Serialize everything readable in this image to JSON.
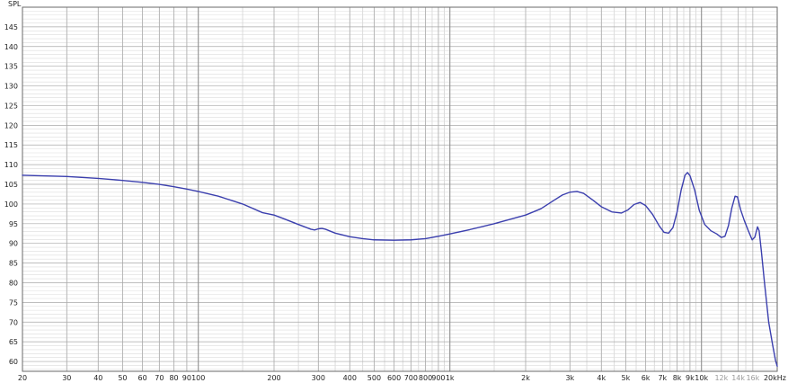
{
  "chart_data": {
    "type": "line",
    "ylabel": "SPL",
    "x_scale": "log",
    "xlim": [
      20,
      20000
    ],
    "ylim": [
      57.5,
      150
    ],
    "grid": true,
    "y_ticks": [
      60,
      65,
      70,
      75,
      80,
      85,
      90,
      95,
      100,
      105,
      110,
      115,
      120,
      125,
      130,
      135,
      140,
      145
    ],
    "x_ticks": [
      {
        "value": 20,
        "label": "20"
      },
      {
        "value": 30,
        "label": "30"
      },
      {
        "value": 40,
        "label": "40"
      },
      {
        "value": 50,
        "label": "50"
      },
      {
        "value": 60,
        "label": "60"
      },
      {
        "value": 70,
        "label": "70"
      },
      {
        "value": 80,
        "label": "80"
      },
      {
        "value": 90,
        "label": "90"
      },
      {
        "value": 100,
        "label": "100"
      },
      {
        "value": 200,
        "label": "200"
      },
      {
        "value": 300,
        "label": "300"
      },
      {
        "value": 400,
        "label": "400"
      },
      {
        "value": 500,
        "label": "500"
      },
      {
        "value": 600,
        "label": "600"
      },
      {
        "value": 700,
        "label": "700"
      },
      {
        "value": 800,
        "label": "800"
      },
      {
        "value": 900,
        "label": "900"
      },
      {
        "value": 1000,
        "label": "1k"
      },
      {
        "value": 2000,
        "label": "2k"
      },
      {
        "value": 3000,
        "label": "3k"
      },
      {
        "value": 4000,
        "label": "4k"
      },
      {
        "value": 5000,
        "label": "5k"
      },
      {
        "value": 6000,
        "label": "6k"
      },
      {
        "value": 7000,
        "label": "7k"
      },
      {
        "value": 8000,
        "label": "8k"
      },
      {
        "value": 9000,
        "label": "9k"
      },
      {
        "value": 10000,
        "label": "10k"
      },
      {
        "value": 12000,
        "label": "12k",
        "muted": true
      },
      {
        "value": 14000,
        "label": "14k",
        "muted": true
      },
      {
        "value": 16000,
        "label": "16k",
        "muted": true
      },
      {
        "value": 20000,
        "label": "20kHz"
      }
    ],
    "colors": {
      "line": "#3b3fae",
      "grid_major": "#a9a9a9",
      "grid_minor": "#dcdcdc",
      "frame": "#6a6a6a"
    },
    "series": [
      {
        "points": [
          [
            20,
            107.3
          ],
          [
            30,
            107
          ],
          [
            40,
            106.5
          ],
          [
            50,
            106
          ],
          [
            60,
            105.5
          ],
          [
            70,
            105
          ],
          [
            80,
            104.4
          ],
          [
            90,
            103.8
          ],
          [
            100,
            103.2
          ],
          [
            120,
            102
          ],
          [
            150,
            100
          ],
          [
            180,
            97.8
          ],
          [
            200,
            97.2
          ],
          [
            220,
            96.2
          ],
          [
            250,
            94.8
          ],
          [
            280,
            93.6
          ],
          [
            290,
            93.4
          ],
          [
            300,
            93.7
          ],
          [
            310,
            93.8
          ],
          [
            320,
            93.6
          ],
          [
            350,
            92.6
          ],
          [
            400,
            91.7
          ],
          [
            450,
            91.2
          ],
          [
            500,
            90.9
          ],
          [
            600,
            90.8
          ],
          [
            700,
            90.9
          ],
          [
            800,
            91.2
          ],
          [
            900,
            91.8
          ],
          [
            1000,
            92.4
          ],
          [
            1200,
            93.5
          ],
          [
            1500,
            95
          ],
          [
            2000,
            97.2
          ],
          [
            2300,
            98.8
          ],
          [
            2600,
            101
          ],
          [
            2800,
            102.3
          ],
          [
            3000,
            103
          ],
          [
            3200,
            103.2
          ],
          [
            3400,
            102.7
          ],
          [
            3700,
            101
          ],
          [
            4000,
            99.3
          ],
          [
            4400,
            98
          ],
          [
            4800,
            97.7
          ],
          [
            5100,
            98.5
          ],
          [
            5400,
            99.9
          ],
          [
            5700,
            100.4
          ],
          [
            6000,
            99.6
          ],
          [
            6400,
            97.3
          ],
          [
            6800,
            94.4
          ],
          [
            7100,
            92.8
          ],
          [
            7400,
            92.6
          ],
          [
            7700,
            94
          ],
          [
            8000,
            98
          ],
          [
            8300,
            103.5
          ],
          [
            8600,
            107.3
          ],
          [
            8800,
            108
          ],
          [
            9000,
            107.2
          ],
          [
            9400,
            103.5
          ],
          [
            9800,
            98.4
          ],
          [
            10300,
            94.8
          ],
          [
            10900,
            93.2
          ],
          [
            11500,
            92.4
          ],
          [
            12000,
            91.5
          ],
          [
            12400,
            91.8
          ],
          [
            12800,
            94.5
          ],
          [
            13200,
            99
          ],
          [
            13600,
            102
          ],
          [
            13900,
            101.8
          ],
          [
            14300,
            98.6
          ],
          [
            14800,
            95.8
          ],
          [
            15400,
            93
          ],
          [
            15900,
            90.9
          ],
          [
            16300,
            91.6
          ],
          [
            16700,
            94.2
          ],
          [
            16950,
            93.2
          ],
          [
            17300,
            88
          ],
          [
            17800,
            80
          ],
          [
            18500,
            70
          ],
          [
            19200,
            64
          ],
          [
            19700,
            60.2
          ],
          [
            20000,
            58.8
          ]
        ]
      }
    ]
  }
}
